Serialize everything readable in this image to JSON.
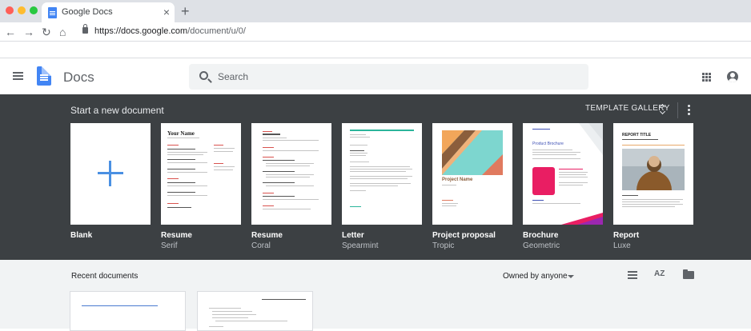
{
  "browser": {
    "tab_title": "Google Docs",
    "tab_close": "×",
    "new_tab": "+",
    "back": "←",
    "forward": "→",
    "reload": "↻",
    "home": "⌂",
    "url_prefix": "https://docs.google.com",
    "url_path": "/document/u/0/"
  },
  "header": {
    "app_name": "Docs",
    "search_placeholder": "Search"
  },
  "templates": {
    "title": "Start a new document",
    "gallery_label": "TEMPLATE GALLERY",
    "items": [
      {
        "name": "Blank",
        "sub": ""
      },
      {
        "name": "Resume",
        "sub": "Serif"
      },
      {
        "name": "Resume",
        "sub": "Coral"
      },
      {
        "name": "Letter",
        "sub": "Spearmint"
      },
      {
        "name": "Project proposal",
        "sub": "Tropic"
      },
      {
        "name": "Brochure",
        "sub": "Geometric"
      },
      {
        "name": "Report",
        "sub": "Luxe"
      }
    ],
    "thumbs": {
      "resume_serif_name": "Your Name",
      "proposal_title": "Project Name",
      "brochure_title": "Product Brochure",
      "report_title": "REPORT TITLE"
    }
  },
  "recent": {
    "title": "Recent documents",
    "owner_filter": "Owned by anyone",
    "sort_label": "AZ"
  },
  "icons": {
    "menu": "menu-icon",
    "search": "search-icon",
    "apps": "apps-icon",
    "account": "account-icon",
    "more": "more-vert-icon",
    "list": "list-view-icon",
    "sort": "sort-az-icon",
    "folder": "folder-icon"
  },
  "colors": {
    "template_panel": "#3c4043",
    "docs_blue": "#4285f4",
    "recent_bg": "#f1f3f4"
  }
}
